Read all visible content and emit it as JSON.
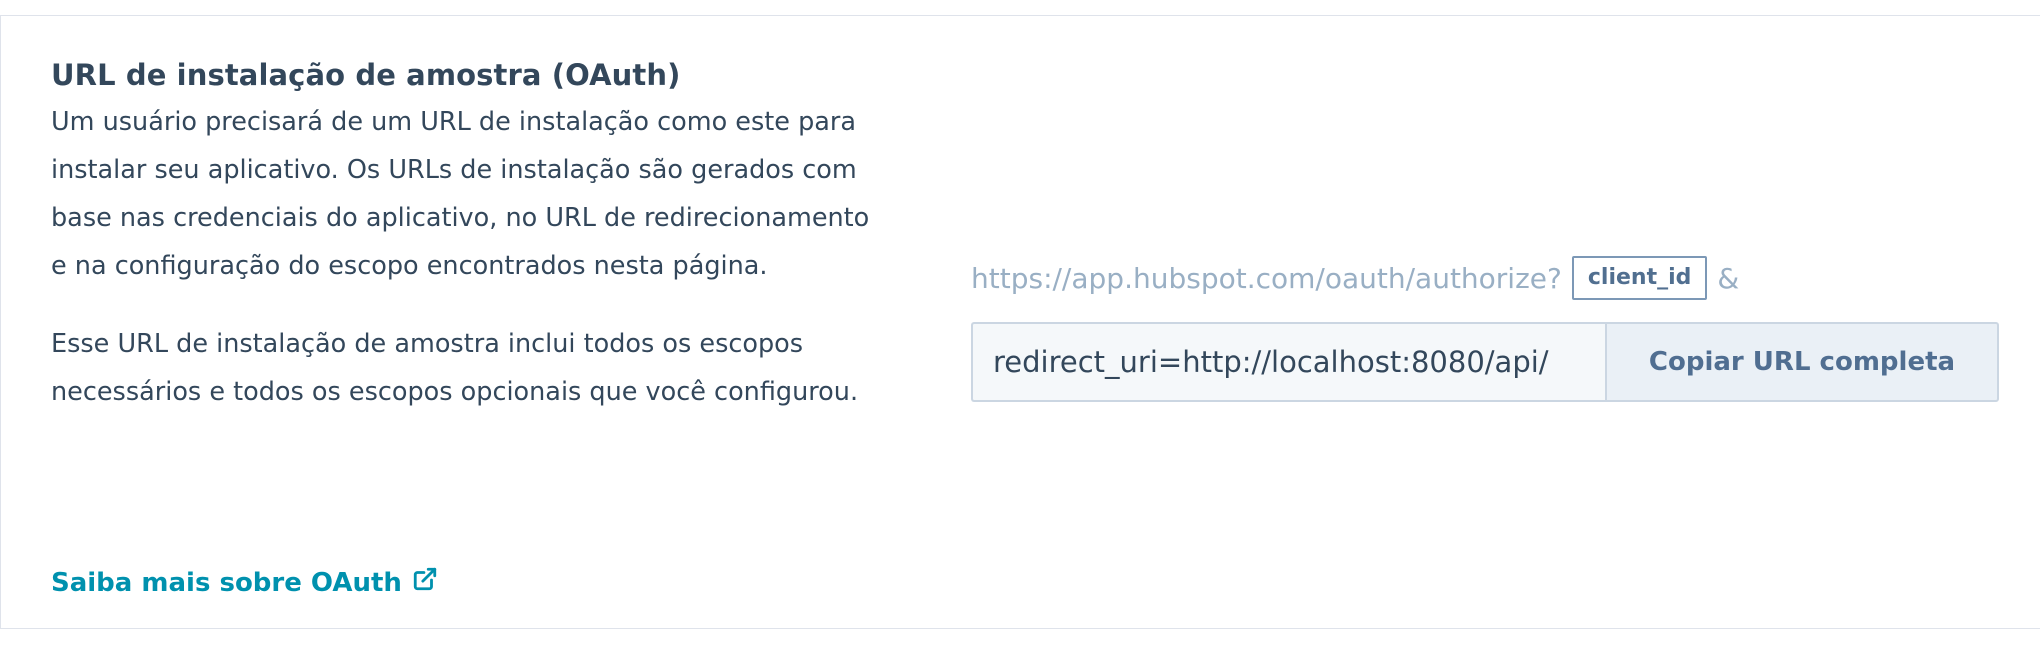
{
  "section": {
    "title": "URL de instalação de amostra (OAuth)",
    "description_1": "Um usuário precisará de um URL de instalação como este para instalar seu aplicativo. Os URLs de instalação são gerados com base nas credenciais do aplicativo, no URL de redirecionamento e na configuração do escopo encontrados nesta página.",
    "description_2": "Esse URL de instalação de amostra inclui todos os escopos necessários e todos os escopos opcionais que você configurou.",
    "learn_more_link": "Saiba mais sobre OAuth",
    "learn_more_icon": "external-link-icon"
  },
  "install_url": {
    "base": "https://app.hubspot.com/oauth/authorize?",
    "param_tag": "client_id",
    "separator": "&",
    "input_value": "redirect_uri=http://localhost:8080/api/",
    "copy_button_label": "Copiar URL completa"
  },
  "colors": {
    "text": "#33475b",
    "link": "#0091ae",
    "muted": "#99afc4",
    "button_bg": "#eaf0f6"
  }
}
